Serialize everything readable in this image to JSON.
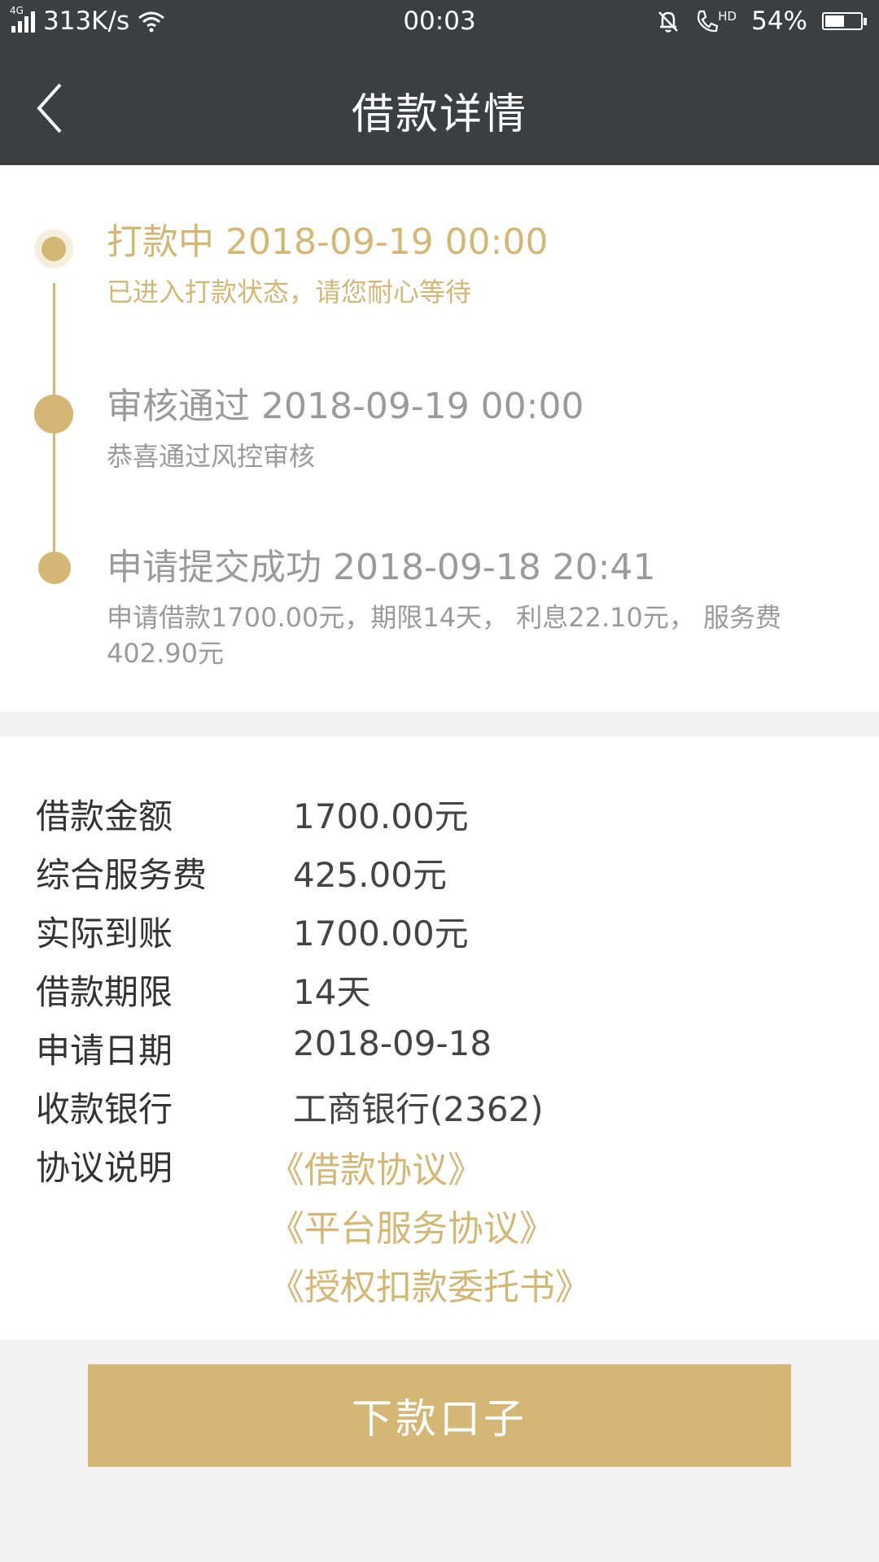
{
  "status_bar": {
    "network": "4G",
    "speed": "313K/s",
    "time": "00:03",
    "hd": "HD",
    "battery": "54%",
    "battery_level": 0.54
  },
  "header": {
    "title": "借款详情"
  },
  "timeline": [
    {
      "title": "打款中 2018-09-19 00:00",
      "desc": "已进入打款状态，请您耐心等待",
      "active": true
    },
    {
      "title": "审核通过 2018-09-19 00:00",
      "desc": "恭喜通过风控审核",
      "active": false
    },
    {
      "title": "申请提交成功 2018-09-18 20:41",
      "desc": "申请借款1700.00元，期限14天， 利息22.10元， 服务费402.90元",
      "active": false
    }
  ],
  "details": [
    {
      "label": "借款金额",
      "value": "1700.00元"
    },
    {
      "label": "综合服务费",
      "value": "425.00元"
    },
    {
      "label": "实际到账",
      "value": "1700.00元"
    },
    {
      "label": "借款期限",
      "value": "14天"
    },
    {
      "label": "申请日期",
      "value": "2018-09-18"
    },
    {
      "label": "收款银行",
      "value": "工商银行(2362)"
    }
  ],
  "agreements": {
    "label": "协议说明",
    "links": [
      "《借款协议》",
      "《平台服务协议》",
      "《授权扣款委托书》"
    ]
  },
  "action_button": {
    "label": "下款口子"
  },
  "colors": {
    "accent": "#d4b774",
    "header_bg": "#3b3f42"
  }
}
